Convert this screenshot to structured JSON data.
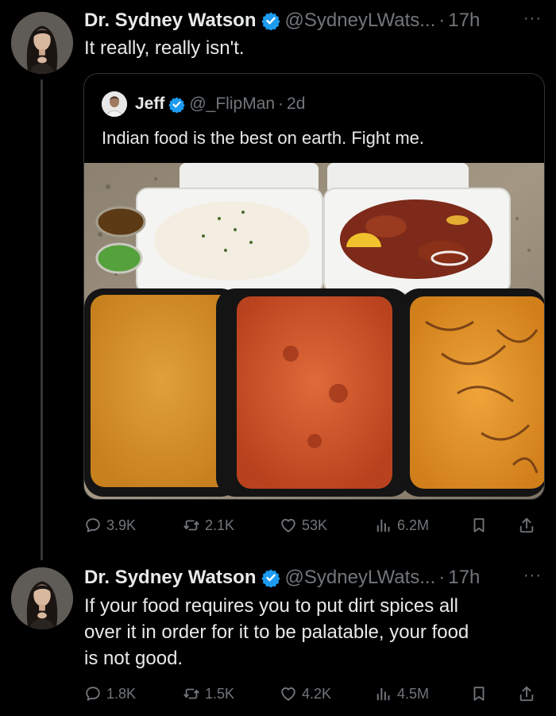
{
  "tweet1": {
    "name": "Dr. Sydney Watson",
    "handle": "@SydneyLWats...",
    "dot": "·",
    "time": "17h",
    "more": "···",
    "text": "It really, really isn't.",
    "actions": {
      "replies": "3.9K",
      "reposts": "2.1K",
      "likes": "53K",
      "views": "6.2M"
    }
  },
  "quote": {
    "name": "Jeff",
    "handle": "@_FlipMan",
    "dot": "·",
    "time": "2d",
    "text": "Indian food is the best on earth. Fight me."
  },
  "tweet2": {
    "name": "Dr. Sydney Watson",
    "handle": "@SydneyLWats...",
    "dot": "·",
    "time": "17h",
    "more": "···",
    "text_lines": [
      "If your food requires you to put dirt spices all",
      "over it in order for it to be palatable, your food",
      "is not good."
    ],
    "actions": {
      "replies": "1.8K",
      "reposts": "1.5K",
      "likes": "4.2K",
      "views": "4.5M"
    }
  },
  "colors": {
    "background": "#000000",
    "text": "#e7e9ea",
    "muted": "#71767b",
    "verified": "#1d9bf0",
    "border": "#2f3336"
  },
  "icons": [
    "reply-icon",
    "repost-icon",
    "like-icon",
    "views-icon",
    "bookmark-icon",
    "share-icon",
    "verified-badge-icon",
    "more-icon"
  ]
}
